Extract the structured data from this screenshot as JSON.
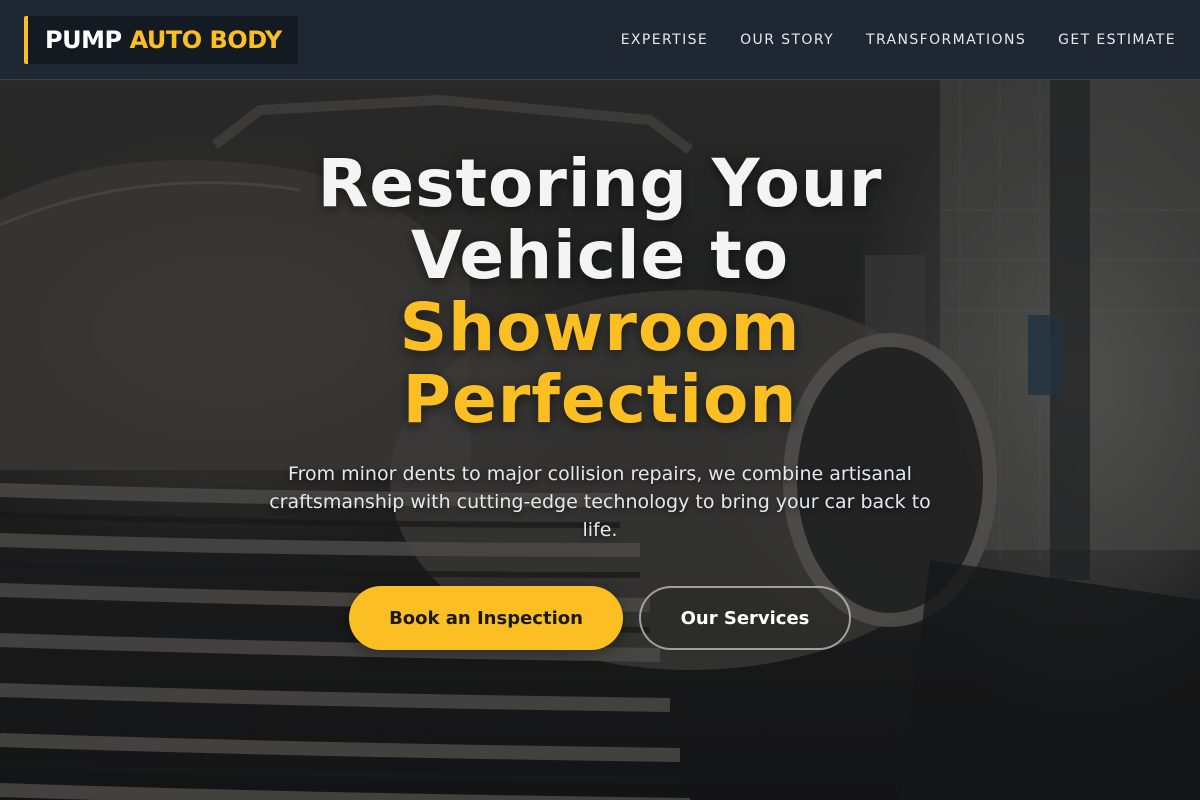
{
  "brand": {
    "name_part1": "PUMP",
    "name_part2": "AUTO BODY",
    "accent_color": "#fbbf24",
    "header_bg": "#1f2733"
  },
  "nav": {
    "items": [
      {
        "label": "EXPERTISE"
      },
      {
        "label": "OUR STORY"
      },
      {
        "label": "TRANSFORMATIONS"
      },
      {
        "label": "GET ESTIMATE"
      }
    ]
  },
  "hero": {
    "title_line1": "Restoring Your",
    "title_line2": "Vehicle to",
    "title_accent_line1": "Showroom",
    "title_accent_line2": "Perfection",
    "subtitle": "From minor dents to major collision repairs, we combine artisanal craftsmanship with cutting-edge technology to bring your car back to life.",
    "primary_cta": "Book an Inspection",
    "secondary_cta": "Our Services"
  }
}
